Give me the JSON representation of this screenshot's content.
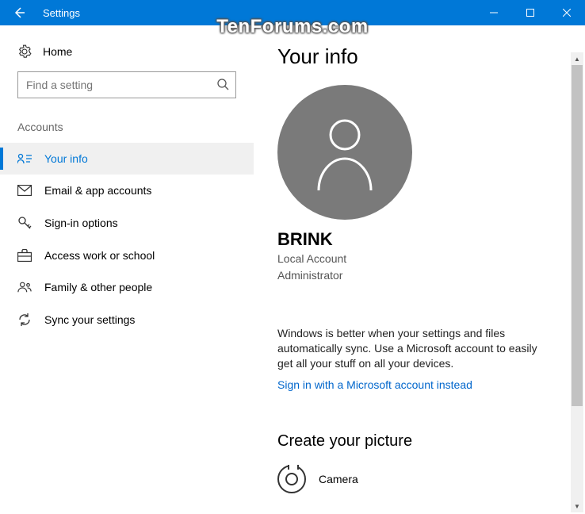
{
  "titlebar": {
    "title": "Settings"
  },
  "watermark": "TenForums.com",
  "sidebar": {
    "home": "Home",
    "search_placeholder": "Find a setting",
    "category": "Accounts",
    "items": [
      {
        "label": "Your info",
        "active": true
      },
      {
        "label": "Email & app accounts",
        "active": false
      },
      {
        "label": "Sign-in options",
        "active": false
      },
      {
        "label": "Access work or school",
        "active": false
      },
      {
        "label": "Family & other people",
        "active": false
      },
      {
        "label": "Sync your settings",
        "active": false
      }
    ]
  },
  "main": {
    "page_title": "Your info",
    "username": "BRINK",
    "account_type_line1": "Local Account",
    "account_type_line2": "Administrator",
    "sync_message": "Windows is better when your settings and files automatically sync. Use a Microsoft account to easily get all your stuff on all your devices.",
    "signin_link": "Sign in with a Microsoft account instead",
    "create_picture_title": "Create your picture",
    "camera_label": "Camera"
  }
}
